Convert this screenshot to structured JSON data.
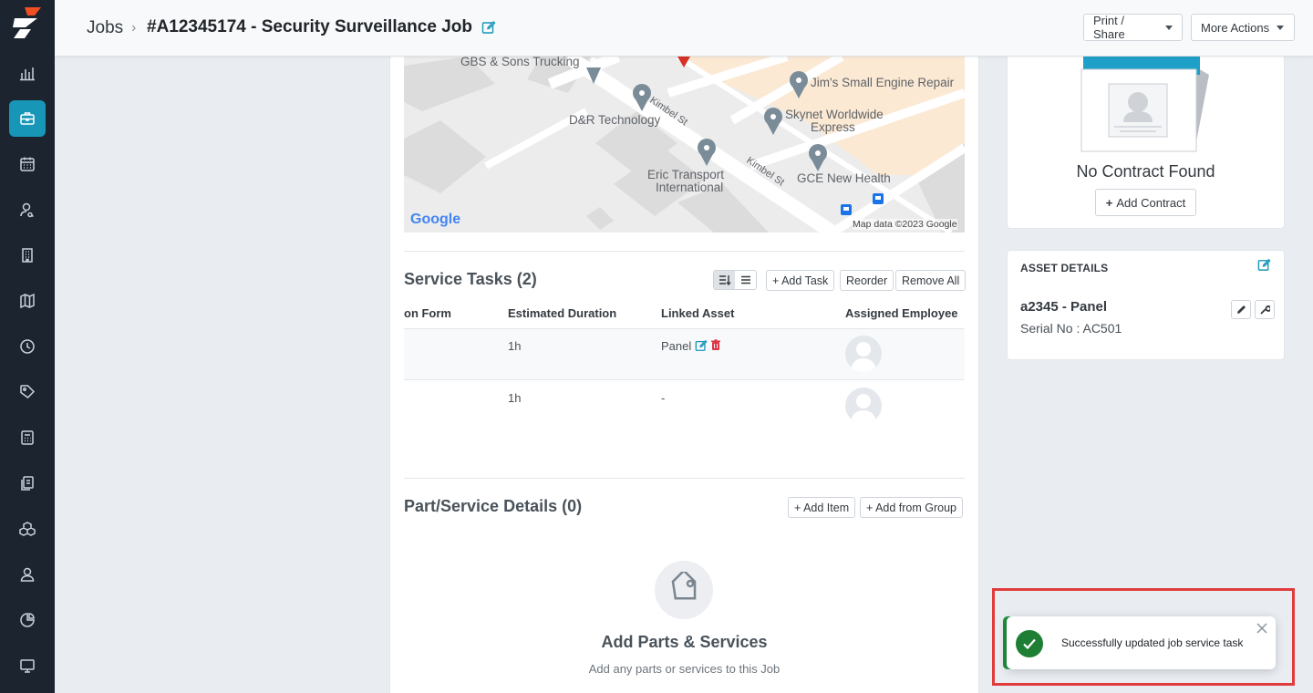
{
  "header": {
    "breadcrumb_root": "Jobs",
    "breadcrumb_separator": "›",
    "job_title": "#A12345174 - Security Surveillance Job",
    "print_share_label": "Print / Share",
    "more_actions_label": "More Actions"
  },
  "sidebar": {
    "items": [
      {
        "icon": "bar-chart-icon",
        "active": false
      },
      {
        "icon": "briefcase-icon",
        "active": true
      },
      {
        "icon": "calendar-icon",
        "active": false
      },
      {
        "icon": "user-search-icon",
        "active": false
      },
      {
        "icon": "building-icon",
        "active": false
      },
      {
        "icon": "map-icon",
        "active": false
      },
      {
        "icon": "clock-icon",
        "active": false
      },
      {
        "icon": "tag-icon",
        "active": false
      },
      {
        "icon": "calculator-icon",
        "active": false
      },
      {
        "icon": "documents-icon",
        "active": false
      },
      {
        "icon": "boxes-icon",
        "active": false
      },
      {
        "icon": "person-icon",
        "active": false
      },
      {
        "icon": "pie-chart-icon",
        "active": false
      },
      {
        "icon": "monitor-icon",
        "active": false
      }
    ]
  },
  "map": {
    "places": [
      "GBS & Sons Trucking",
      "Jim's Small Engine Repair",
      "D&R Technology",
      "Skynet Worldwide",
      "Express",
      "Eric Transport",
      "International",
      "GCE New Health"
    ],
    "streets": [
      "Kimbel St",
      "Kimbel St"
    ],
    "google_label": "Google",
    "attribution": "Map data ©2023 Google"
  },
  "service_tasks": {
    "title": "Service Tasks (2)",
    "add_task_label": "+ Add Task",
    "reorder_label": "Reorder",
    "remove_all_label": "Remove All",
    "columns": [
      "on Form",
      "Estimated Duration",
      "Linked Asset",
      "Assigned Employee"
    ],
    "rows": [
      {
        "duration": "1h",
        "asset": "Panel"
      },
      {
        "duration": "1h",
        "asset": "-"
      }
    ]
  },
  "parts": {
    "title": "Part/Service Details (0)",
    "add_item_label": "+ Add Item",
    "add_group_label": "+ Add from Group",
    "empty_title": "Add Parts & Services",
    "empty_subtitle": "Add any parts or services to this Job"
  },
  "contract": {
    "empty_text": "No Contract Found",
    "add_label": "Add Contract"
  },
  "asset_details": {
    "heading": "ASSET DETAILS",
    "name": "a2345 - Panel",
    "serial": "Serial No : AC501"
  },
  "toast": {
    "message": "Successfully updated job service task"
  },
  "colors": {
    "sidebar_bg": "#1c2430",
    "active_accent": "#1796b8",
    "success": "#1e7e34",
    "highlight_frame": "#e03c3c",
    "delete_red": "#dc3545"
  }
}
